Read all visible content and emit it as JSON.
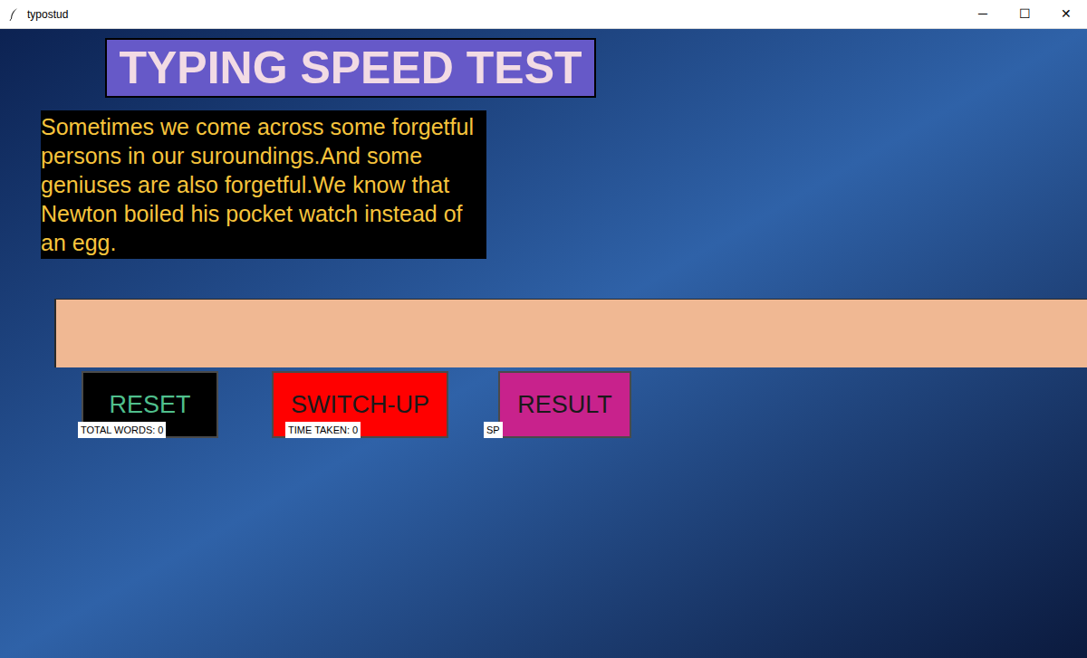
{
  "window": {
    "title": "typostud",
    "controls": [
      "─",
      "☐",
      "✕"
    ]
  },
  "heading": "TYPING SPEED TEST",
  "passage": "Sometimes we come across some forgetful persons in our suroundings.And some geniuses are also forgetful.We know that Newton boiled his pocket watch instead of an egg.",
  "entry": {
    "value": ""
  },
  "buttons": [
    {
      "label": "RESET",
      "color": "#000000",
      "text_color": "#4fbf8c"
    },
    {
      "label": "SWITCH-UP",
      "color": "#ff0000",
      "text_color": "#1a1a1a"
    },
    {
      "label": "RESULT",
      "color": "#c8228c",
      "text_color": "#1a1a1a"
    }
  ],
  "stats": [
    {
      "label": "TOTAL WORDS: 0"
    },
    {
      "label": "TIME TAKEN: 0"
    },
    {
      "label": "SP"
    }
  ]
}
